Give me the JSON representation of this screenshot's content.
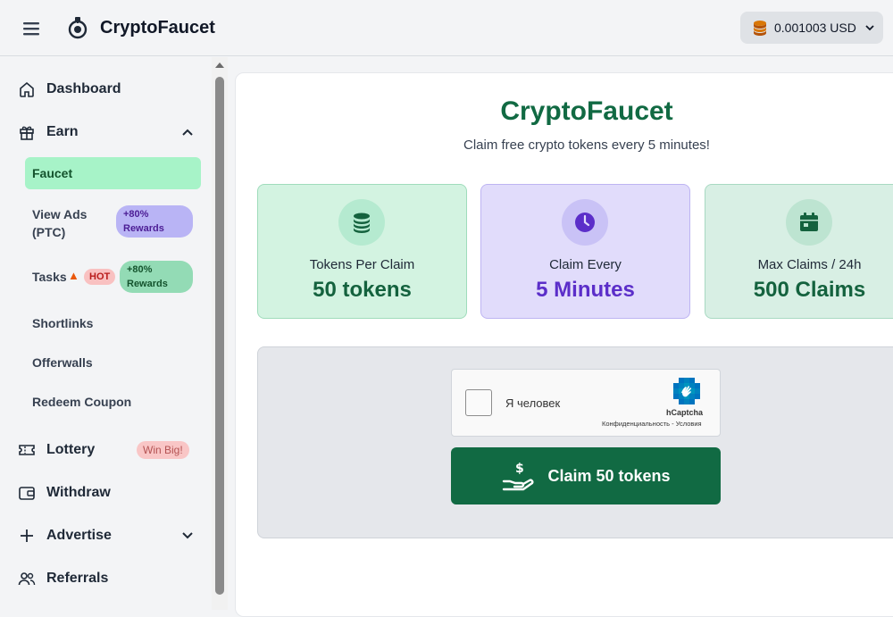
{
  "header": {
    "brand": "CryptoFaucet",
    "balance": "0.001003 USD"
  },
  "sidebar": {
    "items": [
      {
        "label": "Dashboard",
        "icon": "home-icon"
      },
      {
        "label": "Earn",
        "icon": "gift-icon"
      },
      {
        "label": "Lottery",
        "icon": "ticket-icon"
      },
      {
        "label": "Withdraw",
        "icon": "wallet-icon"
      },
      {
        "label": "Advertise",
        "icon": "plus-icon"
      },
      {
        "label": "Referrals",
        "icon": "users-icon"
      }
    ],
    "earn_sub": [
      {
        "label": "Faucet",
        "active": true
      },
      {
        "label": "View Ads (PTC)",
        "badge": "+80% Rewards"
      },
      {
        "label": "Tasks",
        "hot": "HOT",
        "badge": "+80% Rewards"
      },
      {
        "label": "Shortlinks"
      },
      {
        "label": "Offerwalls"
      },
      {
        "label": "Redeem Coupon"
      }
    ],
    "lottery_badge": "Win Big!"
  },
  "main": {
    "title": "CryptoFaucet",
    "subtitle": "Claim free crypto tokens every 5 minutes!",
    "stats": [
      {
        "caption": "Tokens Per Claim",
        "value": "50 tokens",
        "icon": "coins-icon"
      },
      {
        "caption": "Claim Every",
        "value": "5 Minutes",
        "icon": "clock-icon"
      },
      {
        "caption": "Max Claims / 24h",
        "value": "500 Claims",
        "icon": "calendar-icon"
      }
    ],
    "captcha": {
      "label": "Я человек",
      "brand": "hCaptcha",
      "links": "Конфиденциальность - Условия"
    },
    "claim_button": "Claim 50 tokens"
  },
  "colors": {
    "accent": "#116a43",
    "active_nav": "#a7f3c8",
    "purple_value": "#5b2ec9"
  }
}
